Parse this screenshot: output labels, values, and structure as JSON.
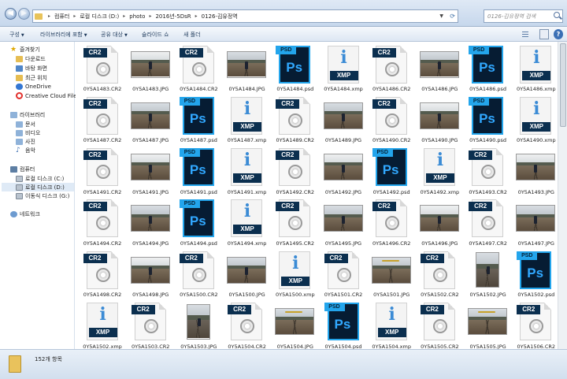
{
  "address": {
    "crumbs": [
      "컴퓨터",
      "로컬 디스크 (D:)",
      "photo",
      "2016년-5DsR",
      "0126-김유정역"
    ],
    "search_placeholder": "0126-김유정역 검색"
  },
  "toolbar": {
    "items": [
      "구성",
      "라이브러리에 포함",
      "공유 대상",
      "슬라이드 쇼",
      "새 폴더"
    ]
  },
  "nav": {
    "favorites_label": "즐겨찾기",
    "favorites": [
      "다운로드",
      "바탕 화면",
      "최근 위치",
      "OneDrive",
      "Creative Cloud Files"
    ],
    "libraries_label": "라이브러리",
    "libraries": [
      "문서",
      "비디오",
      "사진",
      "음악"
    ],
    "computer_label": "컴퓨터",
    "drives": [
      "로컬 디스크 (C:)",
      "로컬 디스크 (D:)",
      "이동식 디스크 (G:)"
    ],
    "network_label": "네트워크"
  },
  "files": [
    {
      "name": "0Y5A1483.CR2",
      "type": "cr2"
    },
    {
      "name": "0Y5A1483.JPG",
      "type": "jpg"
    },
    {
      "name": "0Y5A1484.CR2",
      "type": "cr2"
    },
    {
      "name": "0Y5A1484.JPG",
      "type": "jpg"
    },
    {
      "name": "0Y5A1484.psd",
      "type": "psd"
    },
    {
      "name": "0Y5A1484.xmp",
      "type": "xmp"
    },
    {
      "name": "0Y5A1486.CR2",
      "type": "cr2"
    },
    {
      "name": "0Y5A1486.JPG",
      "type": "jpg"
    },
    {
      "name": "0Y5A1486.psd",
      "type": "psd"
    },
    {
      "name": "0Y5A1486.xmp",
      "type": "xmp"
    },
    {
      "name": "0Y5A1487.CR2",
      "type": "cr2"
    },
    {
      "name": "0Y5A1487.JPG",
      "type": "jpg"
    },
    {
      "name": "0Y5A1487.psd",
      "type": "psd"
    },
    {
      "name": "0Y5A1487.xmp",
      "type": "xmp"
    },
    {
      "name": "0Y5A1489.CR2",
      "type": "cr2"
    },
    {
      "name": "0Y5A1489.JPG",
      "type": "jpg"
    },
    {
      "name": "0Y5A1490.CR2",
      "type": "cr2"
    },
    {
      "name": "0Y5A1490.JPG",
      "type": "jpg"
    },
    {
      "name": "0Y5A1490.psd",
      "type": "psd"
    },
    {
      "name": "0Y5A1490.xmp",
      "type": "xmp"
    },
    {
      "name": "0Y5A1491.CR2",
      "type": "cr2"
    },
    {
      "name": "0Y5A1491.JPG",
      "type": "jpg"
    },
    {
      "name": "0Y5A1491.psd",
      "type": "psd"
    },
    {
      "name": "0Y5A1491.xmp",
      "type": "xmp"
    },
    {
      "name": "0Y5A1492.CR2",
      "type": "cr2"
    },
    {
      "name": "0Y5A1492.JPG",
      "type": "jpg"
    },
    {
      "name": "0Y5A1492.psd",
      "type": "psd"
    },
    {
      "name": "0Y5A1492.xmp",
      "type": "xmp"
    },
    {
      "name": "0Y5A1493.CR2",
      "type": "cr2"
    },
    {
      "name": "0Y5A1493.JPG",
      "type": "jpg"
    },
    {
      "name": "0Y5A1494.CR2",
      "type": "cr2"
    },
    {
      "name": "0Y5A1494.JPG",
      "type": "jpg"
    },
    {
      "name": "0Y5A1494.psd",
      "type": "psd"
    },
    {
      "name": "0Y5A1494.xmp",
      "type": "xmp"
    },
    {
      "name": "0Y5A1495.CR2",
      "type": "cr2"
    },
    {
      "name": "0Y5A1495.JPG",
      "type": "jpg"
    },
    {
      "name": "0Y5A1496.CR2",
      "type": "cr2"
    },
    {
      "name": "0Y5A1496.JPG",
      "type": "jpg"
    },
    {
      "name": "0Y5A1497.CR2",
      "type": "cr2"
    },
    {
      "name": "0Y5A1497.JPG",
      "type": "jpg"
    },
    {
      "name": "0Y5A1498.CR2",
      "type": "cr2"
    },
    {
      "name": "0Y5A1498.JPG",
      "type": "jpg"
    },
    {
      "name": "0Y5A1500.CR2",
      "type": "cr2"
    },
    {
      "name": "0Y5A1500.JPG",
      "type": "jpg"
    },
    {
      "name": "0Y5A1500.xmp",
      "type": "xmp"
    },
    {
      "name": "0Y5A1501.CR2",
      "type": "cr2"
    },
    {
      "name": "0Y5A1501.JPG",
      "type": "jpg"
    },
    {
      "name": "0Y5A1502.CR2",
      "type": "cr2"
    },
    {
      "name": "0Y5A1502.JPG",
      "type": "jpgt"
    },
    {
      "name": "0Y5A1502.psd",
      "type": "psd"
    },
    {
      "name": "0Y5A1502.xmp",
      "type": "xmp"
    },
    {
      "name": "0Y5A1503.CR2",
      "type": "cr2"
    },
    {
      "name": "0Y5A1503.JPG",
      "type": "jpgt"
    },
    {
      "name": "0Y5A1504.CR2",
      "type": "cr2"
    },
    {
      "name": "0Y5A1504.JPG",
      "type": "jpg"
    },
    {
      "name": "0Y5A1504.psd",
      "type": "psd"
    },
    {
      "name": "0Y5A1504.xmp",
      "type": "xmp"
    },
    {
      "name": "0Y5A1505.CR2",
      "type": "cr2"
    },
    {
      "name": "0Y5A1505.JPG",
      "type": "jpg"
    },
    {
      "name": "0Y5A1506.CR2",
      "type": "cr2"
    }
  ],
  "tags": {
    "cr2": "CR2",
    "psd": "PSD",
    "ps": "Ps",
    "xmp": "XMP",
    "info": "i"
  },
  "status": {
    "count": "152개 항목"
  }
}
